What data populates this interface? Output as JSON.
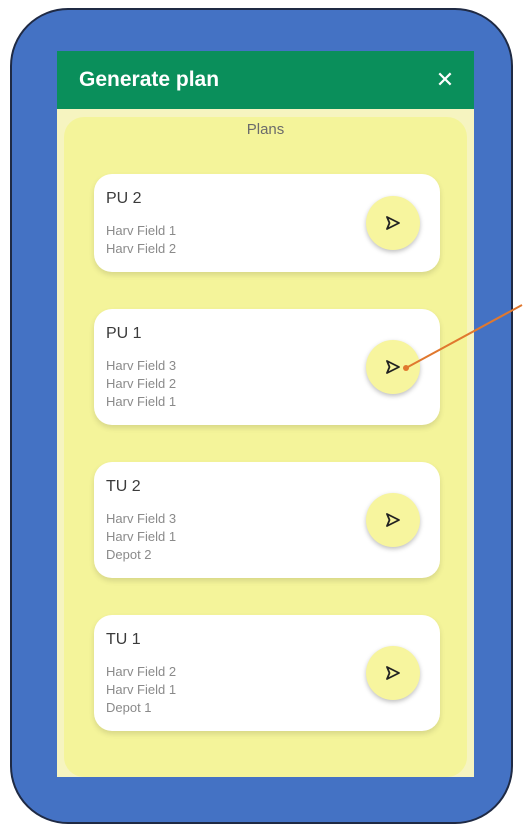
{
  "dialog": {
    "title": "Generate plan",
    "close_glyph": "✕"
  },
  "panel": {
    "title": "Plans"
  },
  "plans": [
    {
      "name": "PU 2",
      "lines": [
        "Harv Field 1",
        "Harv Field 2"
      ]
    },
    {
      "name": "PU 1",
      "lines": [
        "Harv Field 3",
        "Harv Field 2",
        "Harv Field 1"
      ]
    },
    {
      "name": "TU 2",
      "lines": [
        "Harv Field 3",
        "Harv Field 1",
        "Depot 2"
      ]
    },
    {
      "name": "TU 1",
      "lines": [
        "Harv Field 2",
        "Harv Field 1",
        "Depot 1"
      ]
    }
  ],
  "icons": {
    "send": "send-icon",
    "close": "close-icon"
  },
  "colors": {
    "frame": "#4472c4",
    "header": "#0a8f5b",
    "panel": "#f4f49a",
    "button": "#f7f59e",
    "annotation_arrow": "#e0782f"
  }
}
